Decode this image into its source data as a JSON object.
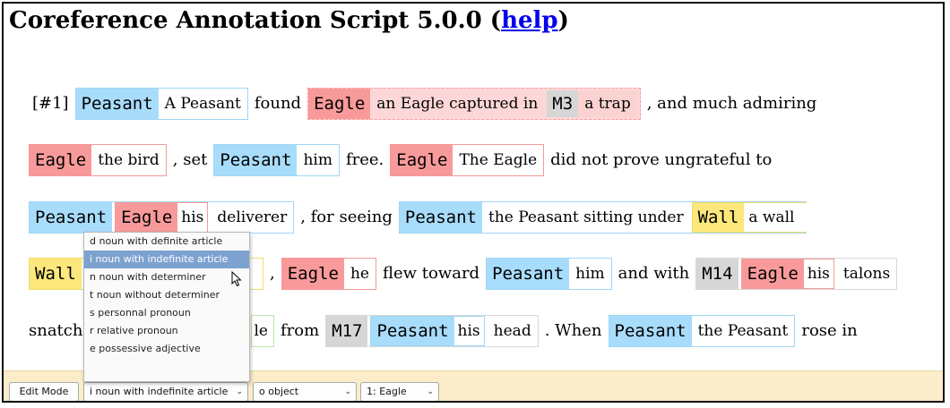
{
  "header": {
    "title": "Coreference Annotation Script 5.0.0 (",
    "help": "help",
    "close": ")"
  },
  "text": {
    "line1": {
      "para": "[#1]",
      "m1": {
        "ent": "Peasant",
        "txt": "A Peasant"
      },
      "w1": "found",
      "sel": {
        "ent": "Eagle",
        "txt": "an Eagle captured in",
        "m3": "M3",
        "m3txt": "a trap"
      },
      "w2": ", and much admiring"
    },
    "line2": {
      "m1": {
        "ent": "Eagle",
        "txt": "the bird"
      },
      "w1": ", set",
      "m2": {
        "ent": "Peasant",
        "txt": "him"
      },
      "w2": "free.",
      "m3": {
        "ent": "Eagle",
        "txt": "The Eagle"
      },
      "w3": "did not prove ungrateful to"
    },
    "line3": {
      "m1": {
        "ent": "Peasant",
        "sub_ent": "Eagle",
        "sub_txt": "his",
        "txt": "deliverer"
      },
      "w1": ", for seeing",
      "m2": {
        "ent": "Peasant",
        "txt": "the Peasant sitting under",
        "sub_ent": "Wall",
        "sub_txt": "a wall"
      }
    },
    "line4": {
      "m1": {
        "ent": "Wall"
      },
      "w1": ",",
      "m2": {
        "ent": "Eagle",
        "txt": "he"
      },
      "w2": "flew toward",
      "m3": {
        "ent": "Peasant",
        "txt": "him"
      },
      "w3": "and with",
      "m4": {
        "ent": "M14",
        "sub_ent": "Eagle",
        "sub_txt": "his",
        "txt": "talons"
      }
    },
    "line5": {
      "w0": "snatch",
      "m0txt": "le",
      "w1": "from",
      "m1": {
        "ent": "M17",
        "sub_ent": "Peasant",
        "sub_txt": "his",
        "txt": "head"
      },
      "w2": ". When",
      "m2": {
        "ent": "Peasant",
        "txt": "the Peasant"
      },
      "w3": "rose in"
    }
  },
  "dropdown": {
    "options": [
      "d noun with definite article",
      "i noun with indefinite article",
      "n noun with determiner",
      "t noun without determiner",
      "s personnal pronoun",
      "r relative pronoun",
      "e possessive adjective"
    ],
    "highlighted_index": 1
  },
  "toolbar": {
    "mode_button": "Edit Mode",
    "type_select": "i noun with indefinite article",
    "role_select": "o object",
    "entity_select": "1: Eagle"
  },
  "icons": {
    "cursor": "pointer-cursor-icon",
    "chevron": "chevron-down-icon"
  },
  "colors": {
    "peasant": "#a8dcfb",
    "eagle": "#f99a9a",
    "wall": "#fbe77c",
    "unknown": "#d6d6d6",
    "toolbar_bg": "#fbedc9",
    "menu_highlight": "#7da2cf"
  }
}
